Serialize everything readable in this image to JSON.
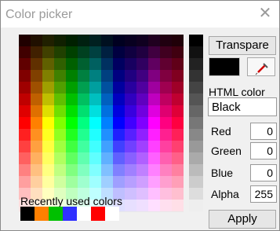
{
  "window": {
    "title": "Color picker",
    "close_glyph": "✕"
  },
  "buttons": {
    "transparent": "Transpare",
    "apply": "Apply"
  },
  "preview": {
    "color": "#000000"
  },
  "html_color": {
    "label": "HTML color",
    "value": "Black"
  },
  "channels": [
    {
      "label": "Red",
      "value": "0"
    },
    {
      "label": "Green",
      "value": "0"
    },
    {
      "label": "Blue",
      "value": "0"
    },
    {
      "label": "Alpha",
      "value": "255"
    }
  ],
  "recent": {
    "label": "Recently used colors",
    "colors": [
      "#000000",
      "#ff8000",
      "#00c000",
      "#3030ff",
      "#ffffff",
      "#ff0000",
      "#ffffff"
    ]
  },
  "palette": {
    "columns": 14,
    "rows": 15,
    "hues": [
      "#ff0000",
      "#ff8000",
      "#ffff00",
      "#80ff00",
      "#00ff00",
      "#00ff80",
      "#00ffff",
      "#0080ff",
      "#0000ff",
      "#4000ff",
      "#8000ff",
      "#ff00ff",
      "#ff0080",
      "#ff0040"
    ],
    "grays": [
      "#000000",
      "#111111",
      "#222222",
      "#333333",
      "#444444",
      "#555555",
      "#666666",
      "#777777",
      "#888888",
      "#999999",
      "#aaaaaa",
      "#bbbbbb",
      "#cccccc",
      "#dddddd",
      "#eeeeee"
    ]
  }
}
